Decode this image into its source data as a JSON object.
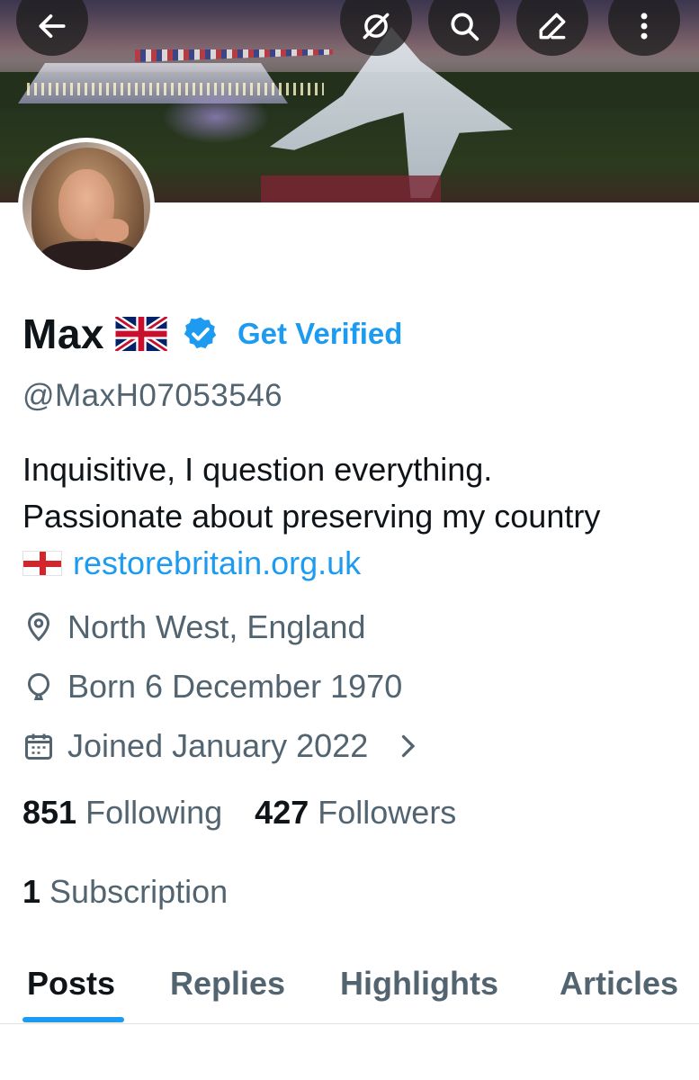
{
  "header": {
    "back_icon": "arrow-left-icon",
    "actions": [
      {
        "name": "grok-icon",
        "label": "Grok"
      },
      {
        "name": "search-icon",
        "label": "Search"
      },
      {
        "name": "compose-icon",
        "label": "Compose"
      },
      {
        "name": "more-icon",
        "label": "More"
      }
    ]
  },
  "profile": {
    "name": "Max",
    "flag_emoji": "🇬🇧",
    "verified_color": "#1d9bf0",
    "get_verified": "Get Verified",
    "handle": "@MaxH07053546",
    "bio_line1": "Inquisitive, I question everything.",
    "bio_line2": "Passionate about preserving my country",
    "bio_flag_emoji": "🏴",
    "bio_link": "restorebritain.org.uk",
    "location": "North West, England",
    "birth": "Born 6 December 1970",
    "joined": "Joined January 2022",
    "following_count": "851",
    "following_label": "Following",
    "followers_count": "427",
    "followers_label": "Followers",
    "subscription_count": "1",
    "subscription_label": "Subscription"
  },
  "tabs": [
    {
      "label": "Posts",
      "active": true
    },
    {
      "label": "Replies",
      "active": false
    },
    {
      "label": "Highlights",
      "active": false
    },
    {
      "label": "Articles",
      "active": false
    }
  ],
  "colors": {
    "accent": "#1d9bf0",
    "text": "#0f1419",
    "secondary": "#536471"
  }
}
